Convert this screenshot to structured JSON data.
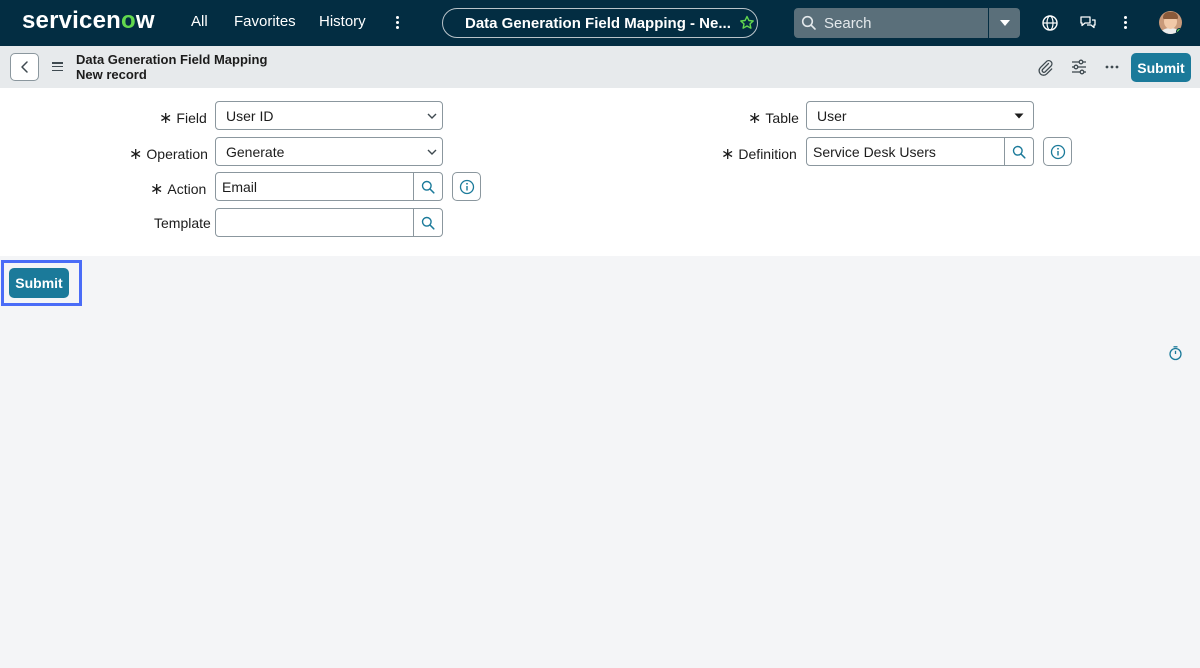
{
  "app": {
    "logo_text": "servicenow",
    "nav_links": [
      "All",
      "Favorites",
      "History"
    ],
    "record_pill": "Data Generation Field Mapping - Ne...",
    "search_placeholder": "Search",
    "colors": {
      "nav_bg": "#032d42",
      "accent": "#1b7a9a",
      "logo_o": "#62d84e",
      "highlight": "#4a6cf7"
    }
  },
  "header": {
    "title": "Data Generation Field Mapping",
    "subtitle": "New record",
    "submit_label": "Submit",
    "icons": [
      "attachment-icon",
      "settings-sliders-icon",
      "more-options-icon"
    ]
  },
  "form": {
    "field": {
      "label": "Field",
      "value": "User ID"
    },
    "operation": {
      "label": "Operation",
      "value": "Generate"
    },
    "action": {
      "label": "Action",
      "value": "Email"
    },
    "template": {
      "label": "Template",
      "value": ""
    },
    "table": {
      "label": "Table",
      "value": "User"
    },
    "definition": {
      "label": "Definition",
      "value": "Service Desk Users"
    }
  },
  "footer": {
    "submit_label": "Submit"
  }
}
